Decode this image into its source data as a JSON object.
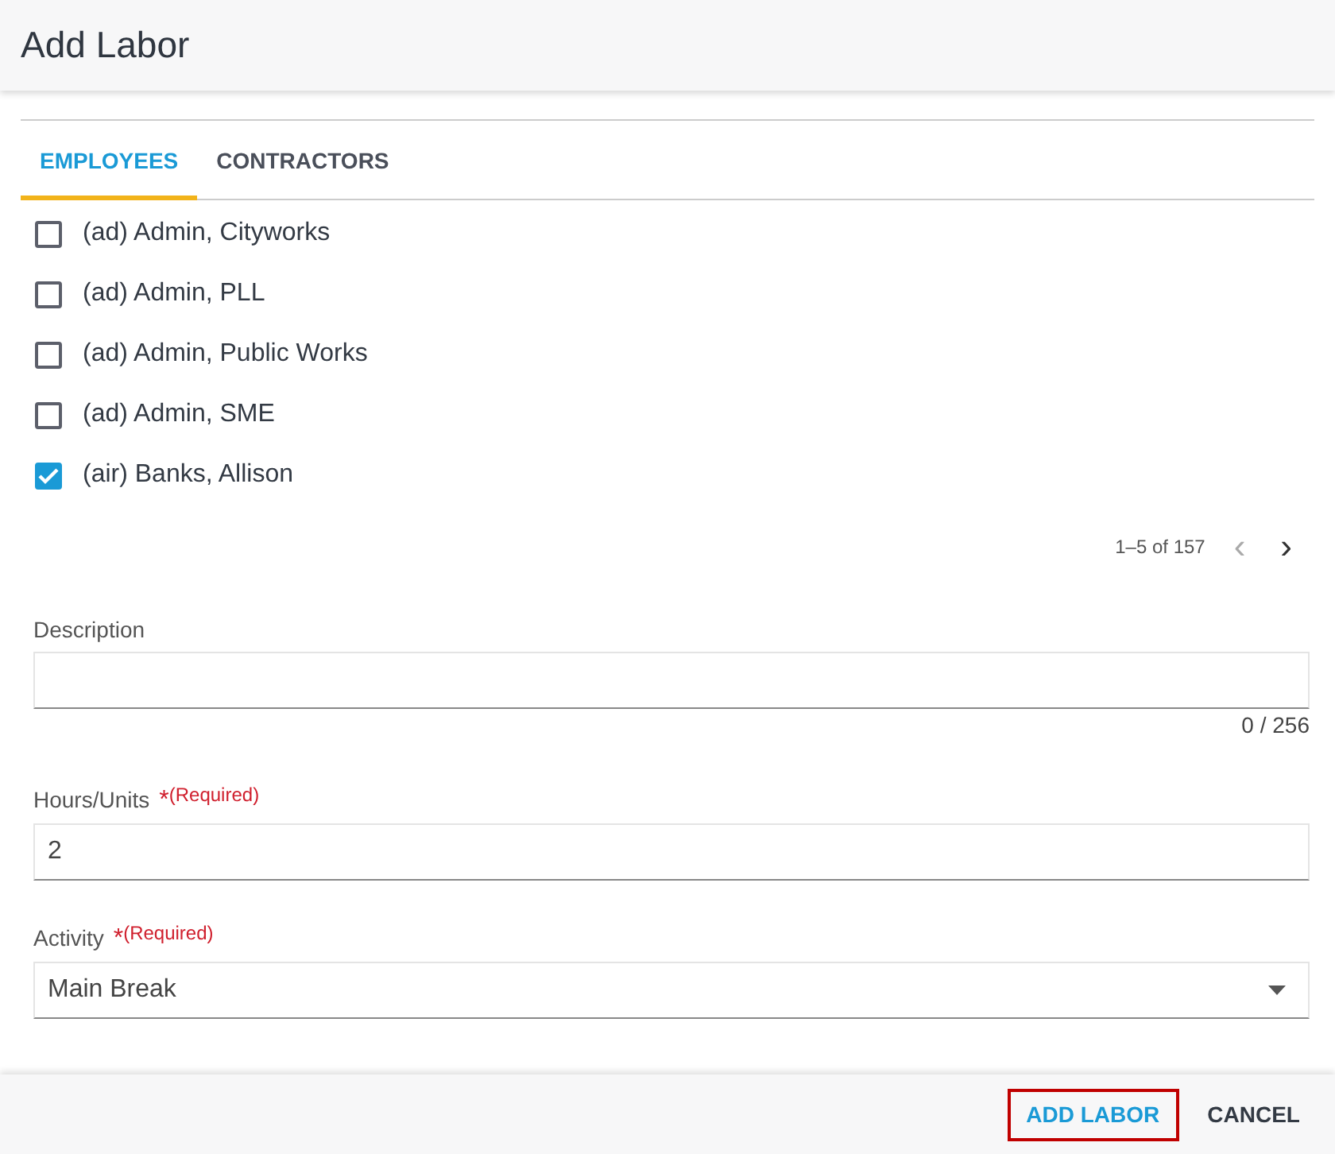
{
  "window": {
    "title": "Add Labor"
  },
  "tabs": [
    {
      "label": "EMPLOYEES",
      "selected": true
    },
    {
      "label": "CONTRACTORS",
      "selected": false
    }
  ],
  "employees": [
    {
      "label": "(ad) Admin, Cityworks",
      "checked": false
    },
    {
      "label": "(ad) Admin, PLL",
      "checked": false
    },
    {
      "label": "(ad) Admin, Public Works",
      "checked": false
    },
    {
      "label": "(ad) Admin, SME",
      "checked": false
    },
    {
      "label": "(air) Banks, Allison",
      "checked": true
    }
  ],
  "pagination": {
    "range": "1–5 of 157",
    "prev": "‹",
    "next": "›"
  },
  "fields": [
    {
      "kind": "text",
      "label": "Description",
      "counter": "0 / 256"
    },
    {
      "kind": "text",
      "label": "Hours/Units",
      "required": "*",
      "required_note": "(Required)",
      "value": "2"
    },
    {
      "kind": "select",
      "label": "Activity",
      "required": "*",
      "required_note": "(Required)",
      "value": "Main Break"
    }
  ],
  "buttons": [
    {
      "label": "ADD LABOR",
      "kind": "primary",
      "highlighted": true
    },
    {
      "label": "CANCEL",
      "kind": "secondary",
      "highlighted": false
    }
  ]
}
